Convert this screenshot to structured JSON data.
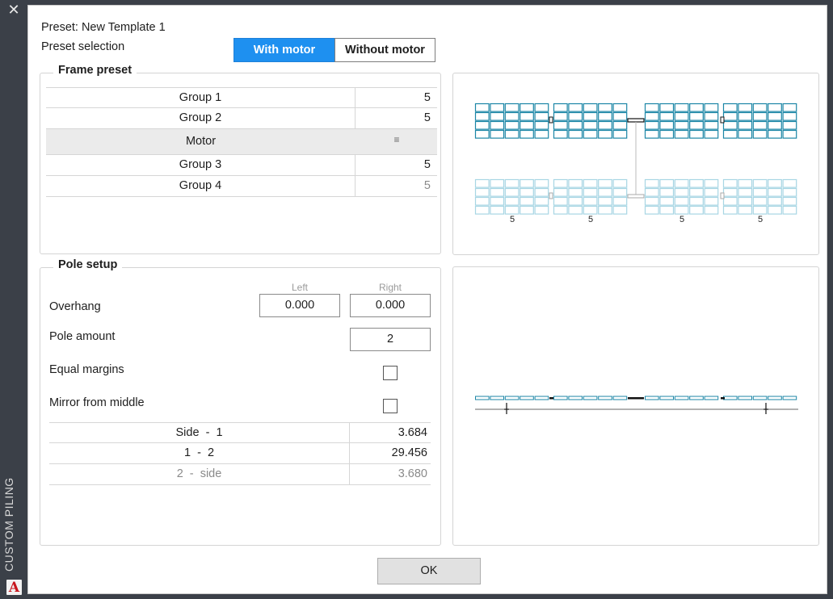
{
  "window": {
    "close_glyph": "✕",
    "vertical_title": "CUSTOM PILING",
    "logo_letter": "A"
  },
  "header": {
    "preset_name": "Preset: New Template 1",
    "preset_selection_label": "Preset selection",
    "options": [
      "With motor",
      "Without motor"
    ],
    "selected_option": "With motor"
  },
  "frame_preset": {
    "title": "Frame preset",
    "rows": [
      {
        "name": "Group 1",
        "value": "5"
      },
      {
        "name": "Group 2",
        "value": "5"
      },
      {
        "name": "Motor",
        "value": "",
        "handle": "≡"
      },
      {
        "name": "Group 3",
        "value": "5"
      },
      {
        "name": "Group 4",
        "value": "5"
      }
    ],
    "diagram_labels": [
      "5",
      "5",
      "5",
      "5"
    ]
  },
  "pole_setup": {
    "title": "Pole setup",
    "left_header": "Left",
    "right_header": "Right",
    "overhang_label": "Overhang",
    "overhang_left": "0.000",
    "overhang_right": "0.000",
    "pole_amount_label": "Pole amount",
    "pole_amount": "2",
    "equal_margins_label": "Equal margins",
    "equal_margins_checked": false,
    "mirror_label": "Mirror from middle",
    "mirror_checked": false,
    "margins": [
      {
        "name": "Side  -  1",
        "value": "3.684"
      },
      {
        "name": "1  -  2",
        "value": "29.456"
      },
      {
        "name": "2  -  side",
        "value": "3.680"
      }
    ]
  },
  "footer": {
    "ok_label": "OK"
  },
  "colors": {
    "accent": "#1e90f0",
    "module_stroke": "#1b86a6",
    "module_stroke_light": "#a8d6e4"
  }
}
